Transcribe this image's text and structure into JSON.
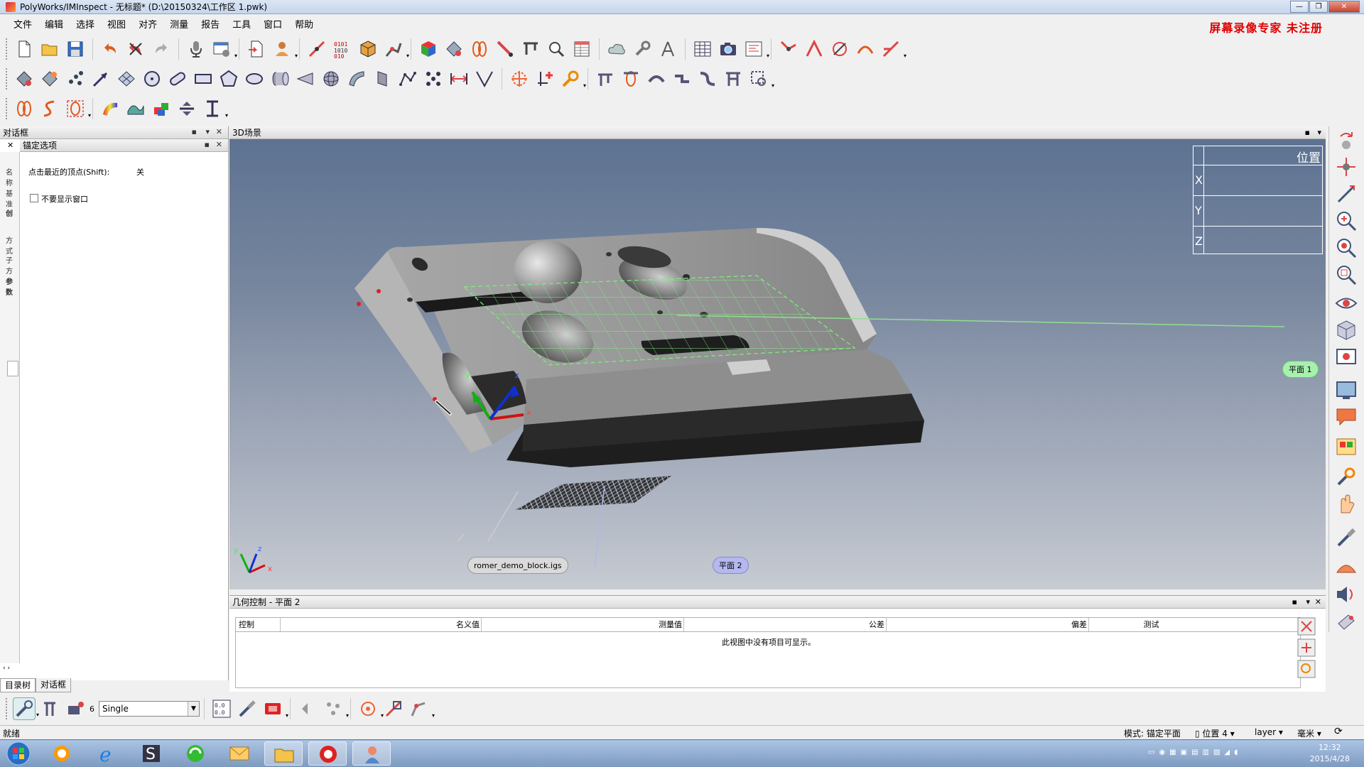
{
  "window": {
    "title": "PolyWorks/IMInspect - 无标题* (D:\\20150324\\工作区 1.pwk)",
    "min_label": "—",
    "max_label": "❐",
    "close_label": "✕"
  },
  "menu": [
    "文件",
    "编辑",
    "选择",
    "视图",
    "对齐",
    "测量",
    "报告",
    "工具",
    "窗口",
    "帮助"
  ],
  "watermark": "屏幕录像专家  未注册",
  "left_panel": {
    "title": "对话框",
    "sub_title": "锚定选项",
    "option_label": "点击最近的顶点(Shift):",
    "option_value": "关",
    "checkbox_label": "不要显示窗口",
    "strip_labels": [
      "名称",
      "基准",
      "创",
      "方式",
      "子方",
      "参数"
    ]
  },
  "viewport": {
    "title": "3D场景",
    "position": {
      "header": "位置",
      "x": "X",
      "y": "Y",
      "z": "Z"
    },
    "labels": {
      "plane1": "平面 1",
      "plane2": "平面 2",
      "model": "romer_demo_block.igs"
    },
    "axes": {
      "x": "x",
      "y": "y",
      "z": "z"
    }
  },
  "bottom_panel": {
    "title": "几何控制 - 平面 2",
    "columns": [
      "控制",
      "名义值",
      "测量值",
      "公差",
      "偏差",
      "测试"
    ],
    "empty_message": "此视图中没有项目可显示。"
  },
  "tabs": [
    "目录树",
    "对话框"
  ],
  "bottom_toolbar": {
    "count": "6",
    "mode": "Single"
  },
  "status": {
    "ready": "就绪",
    "mode": "模式: 锚定平面",
    "position": "位置 4",
    "layer": "layer",
    "unit": "毫米"
  },
  "taskbar": {
    "time": "12:32",
    "date": "2015/4/28"
  }
}
